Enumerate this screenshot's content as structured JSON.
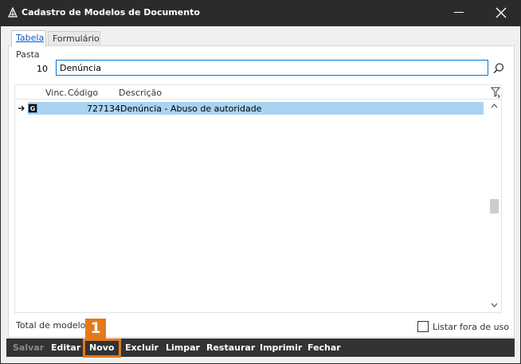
{
  "window": {
    "title": "Cadastro de Modelos de Documento"
  },
  "tabs": [
    {
      "label": "Tabela"
    },
    {
      "label": "Formulário"
    }
  ],
  "pasta": {
    "label": "Pasta",
    "code": "10",
    "value": "Denúncia"
  },
  "grid": {
    "columns": [
      "Vinc.",
      "Código",
      "Descrição"
    ],
    "rows": [
      {
        "badge": "G",
        "codigo": "727134",
        "descricao": "Denúncia - Abuso de autoridade"
      }
    ]
  },
  "footer": {
    "total_label": "Total de modelos",
    "listar_label": "Listar fora de uso",
    "listar_checked": false
  },
  "toolbar": {
    "salvar": "Salvar",
    "editar": "Editar",
    "novo": "Novo",
    "excluir": "Excluir",
    "limpar": "Limpar",
    "restaurar": "Restaurar",
    "imprimir": "Imprimir",
    "fechar": "Fechar"
  },
  "annotation": {
    "step": "1",
    "color": "#e3791b"
  },
  "colors": {
    "titlebar": "#2b2b2b",
    "selected_row": "#a9d3f3",
    "focus_border": "#0078d7",
    "toolbar": "#333333"
  }
}
